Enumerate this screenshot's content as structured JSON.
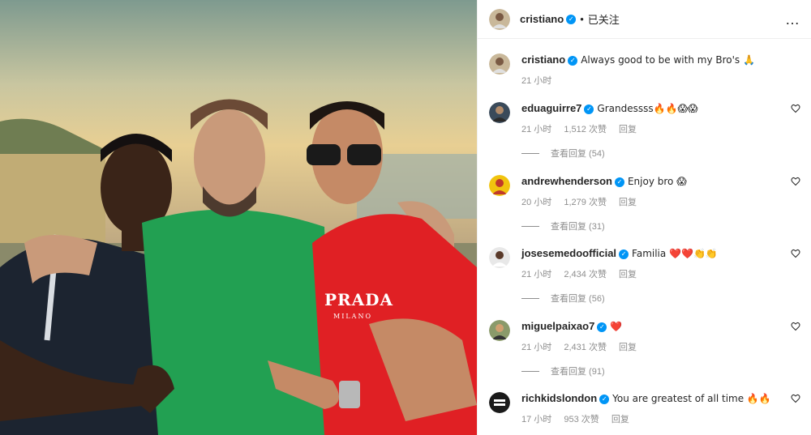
{
  "post": {
    "author": "cristiano",
    "follow_label": "已关注",
    "separator": "•",
    "more_icon": "…",
    "caption": {
      "username": "cristiano",
      "text": "Always good to be with my Bro's 🙏",
      "time": "21 小时"
    },
    "shirt_brand": "PRADA",
    "shirt_city": "MILANO"
  },
  "comments": [
    {
      "username": "eduaguirre7",
      "verified": true,
      "text": "Grandessss🔥🔥😱😱",
      "time": "21 小时",
      "likes": "1,512 次赞",
      "reply": "回复",
      "view_replies": "查看回复 (54)"
    },
    {
      "username": "andrewhenderson",
      "verified": true,
      "text": "Enjoy bro 😱",
      "time": "20 小时",
      "likes": "1,279 次赞",
      "reply": "回复",
      "view_replies": "查看回复 (31)"
    },
    {
      "username": "josesemedoofficial",
      "verified": true,
      "text": "Familia ❤️❤️👏👏",
      "time": "21 小时",
      "likes": "2,434 次赞",
      "reply": "回复",
      "view_replies": "查看回复 (56)"
    },
    {
      "username": "miguelpaixao7",
      "verified": true,
      "text": "❤️",
      "time": "21 小时",
      "likes": "2,431 次赞",
      "reply": "回复",
      "view_replies": "查看回复 (91)"
    },
    {
      "username": "richkidslondon",
      "verified": true,
      "text": "You are greatest of all time 🔥🔥",
      "time": "17 小时",
      "likes": "953 次赞",
      "reply": "回复",
      "view_replies": ""
    }
  ],
  "colors": {
    "verified": "#0095f6",
    "meta": "#8e8e8e",
    "text": "#262626",
    "border": "#efefef"
  },
  "icons": [
    "verified-badge-icon",
    "more-options-icon",
    "heart-outline-icon"
  ]
}
